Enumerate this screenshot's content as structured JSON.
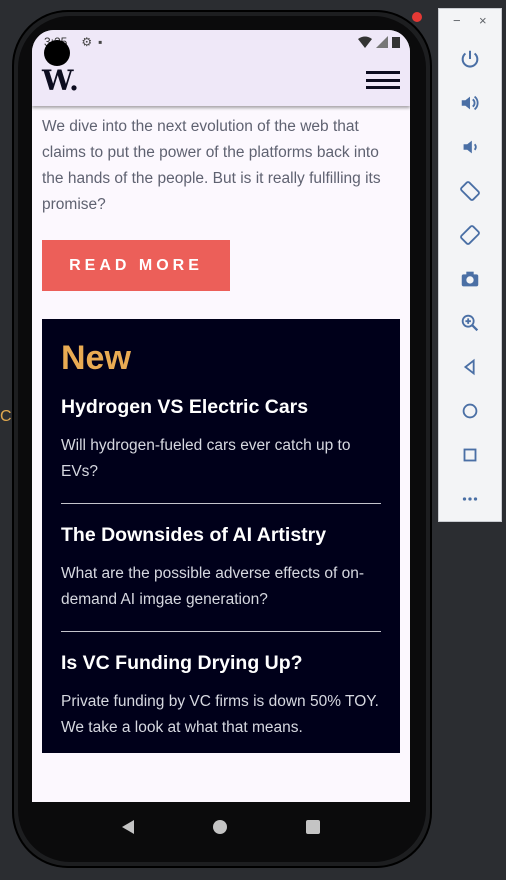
{
  "side_letter": "C",
  "status": {
    "time": "3:25"
  },
  "header": {
    "logo": "W."
  },
  "intro": {
    "text": "We dive into the next evolution of the web that claims to put the power of the platforms back into the hands of the people. But is it really fulfilling its promise?",
    "button_label": "READ MORE"
  },
  "new_section": {
    "title": "New",
    "items": [
      {
        "title": "Hydrogen VS Electric Cars",
        "desc": "Will hydrogen-fueled cars ever catch up to EVs?"
      },
      {
        "title": "The Downsides of AI Artistry",
        "desc": "What are the possible adverse effects of on-demand AI imgae generation?"
      },
      {
        "title": "Is VC Funding Drying Up?",
        "desc": "Private funding by VC firms is down 50% TOY. We take a look at what that means."
      }
    ]
  },
  "toolbar": {
    "minimize": "−",
    "close": "×",
    "buttons": [
      "power-icon",
      "volume-up-icon",
      "volume-down-icon",
      "rotate-left-icon",
      "rotate-right-icon",
      "camera-icon",
      "zoom-icon",
      "back-icon",
      "home-icon",
      "overview-icon",
      "more-icon"
    ]
  },
  "colors": {
    "accent": "#ec5f59",
    "new_title": "#e9ab53",
    "dark_box": "#00001a",
    "header_bg": "#efe8f8"
  }
}
